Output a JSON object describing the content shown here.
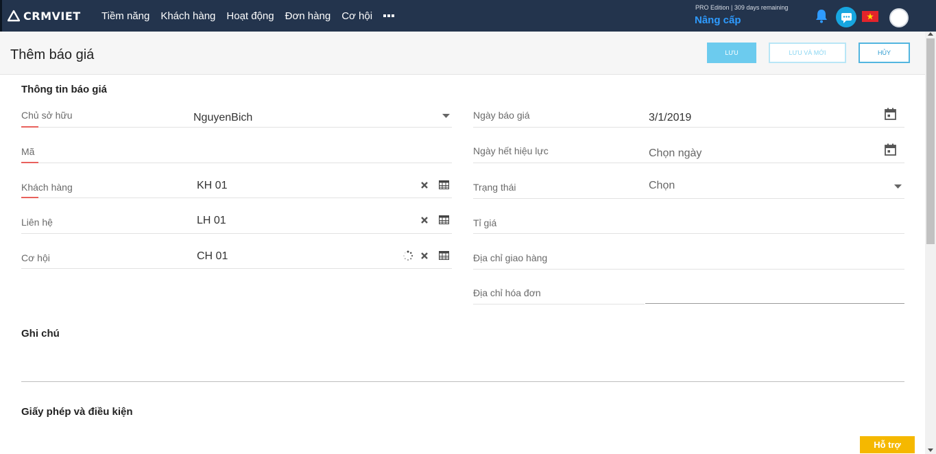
{
  "app": {
    "logo_text": "CRMVIET"
  },
  "nav": {
    "items": [
      {
        "label": "Tiềm năng"
      },
      {
        "label": "Khách hàng"
      },
      {
        "label": "Hoạt động"
      },
      {
        "label": "Đơn hàng"
      },
      {
        "label": "Cơ hội"
      }
    ],
    "more_icon": "more-dots-icon"
  },
  "account": {
    "edition": "PRO Edition | 309 days remaining",
    "upgrade_label": "Nâng cấp",
    "icons": [
      "bell-icon",
      "chat-icon",
      "vietnam-flag-icon",
      "avatar"
    ]
  },
  "page": {
    "title": "Thêm báo giá",
    "buttons": {
      "save": "LƯU",
      "save_new": "LƯU VÀ MỚI",
      "cancel": "HỦY"
    }
  },
  "form": {
    "section_info": "Thông tin báo giá",
    "left": [
      {
        "label": "Chủ sở hữu",
        "value": "NguyenBich"
      },
      {
        "label": "Mã",
        "value": ""
      },
      {
        "label": "Khách hàng",
        "value": "KH 01"
      },
      {
        "label": "Liên hệ",
        "value": "LH 01"
      },
      {
        "label": "Cơ hội",
        "value": "CH 01"
      }
    ],
    "right": [
      {
        "label": "Ngày báo giá",
        "value": "3/1/2019"
      },
      {
        "label": "Ngày hết hiệu lực",
        "value": "Chọn ngày"
      },
      {
        "label": "Trạng thái",
        "value": "Chọn"
      },
      {
        "label": "Tỉ giá",
        "value": ""
      },
      {
        "label": "Địa chỉ giao hàng",
        "value": ""
      },
      {
        "label": "Địa chỉ hóa đơn",
        "value": ""
      }
    ],
    "section_notes": "Ghi chú",
    "section_terms": "Giấy phép và điều kiện"
  },
  "support": {
    "label": "Hỗ trợ"
  },
  "colors": {
    "nav_bg": "#23344d",
    "accent": "#2e9bff",
    "required": "#e8605c",
    "support": "#f5b800"
  }
}
